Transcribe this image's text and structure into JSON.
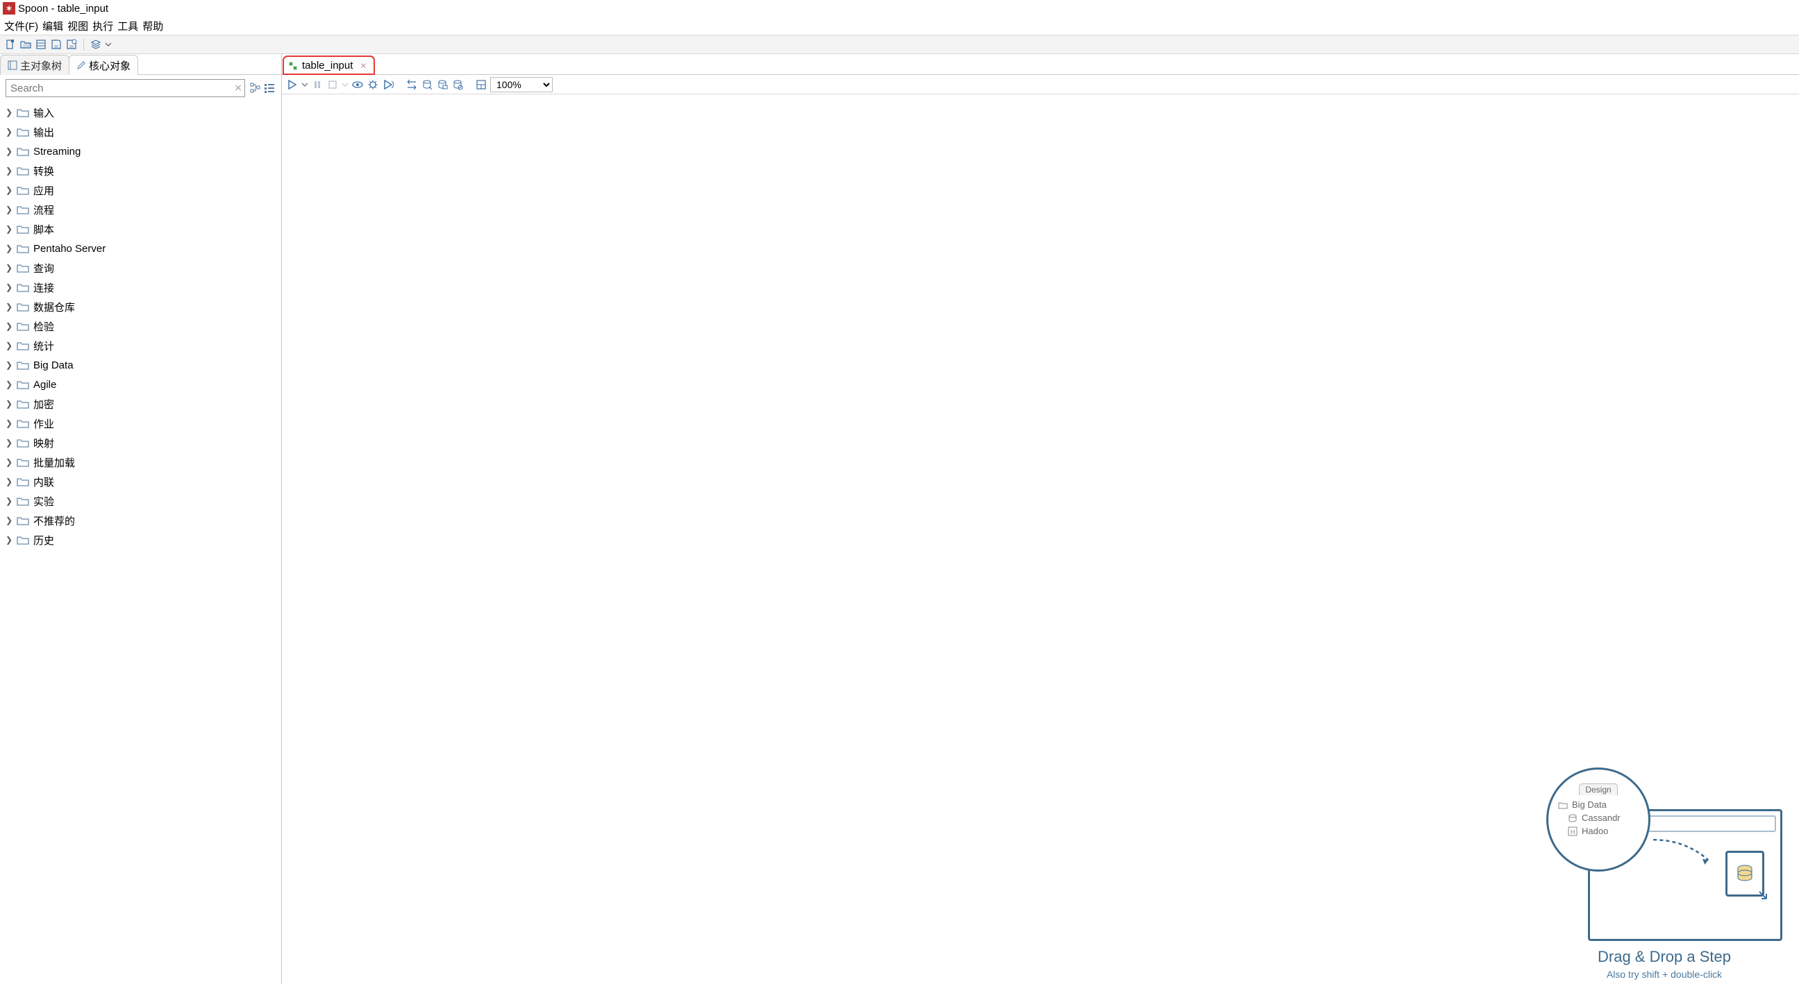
{
  "title": "Spoon - table_input",
  "menu": {
    "file": "文件(F)",
    "edit": "编辑",
    "view": "视图",
    "run": "执行",
    "tools": "工具",
    "help": "帮助"
  },
  "panel_tabs": {
    "main_tree": "主对象树",
    "core_objects": "核心对象"
  },
  "search": {
    "placeholder": "Search"
  },
  "tree_items": [
    "输入",
    "输出",
    "Streaming",
    "转换",
    "应用",
    "流程",
    "脚本",
    "Pentaho Server",
    "查询",
    "连接",
    "数据仓库",
    "检验",
    "统计",
    "Big Data",
    "Agile",
    "加密",
    "作业",
    "映射",
    "批量加载",
    "内联",
    "实验",
    "不推荐的",
    "历史"
  ],
  "doc_tab": {
    "label": "table_input"
  },
  "zoom": "100%",
  "hint": {
    "design_tab": "Design",
    "row1": "Big Data",
    "row2": "Cassandr",
    "row3": "Hadoo",
    "title": "Drag & Drop a Step",
    "sub": "Also try shift + double-click"
  }
}
